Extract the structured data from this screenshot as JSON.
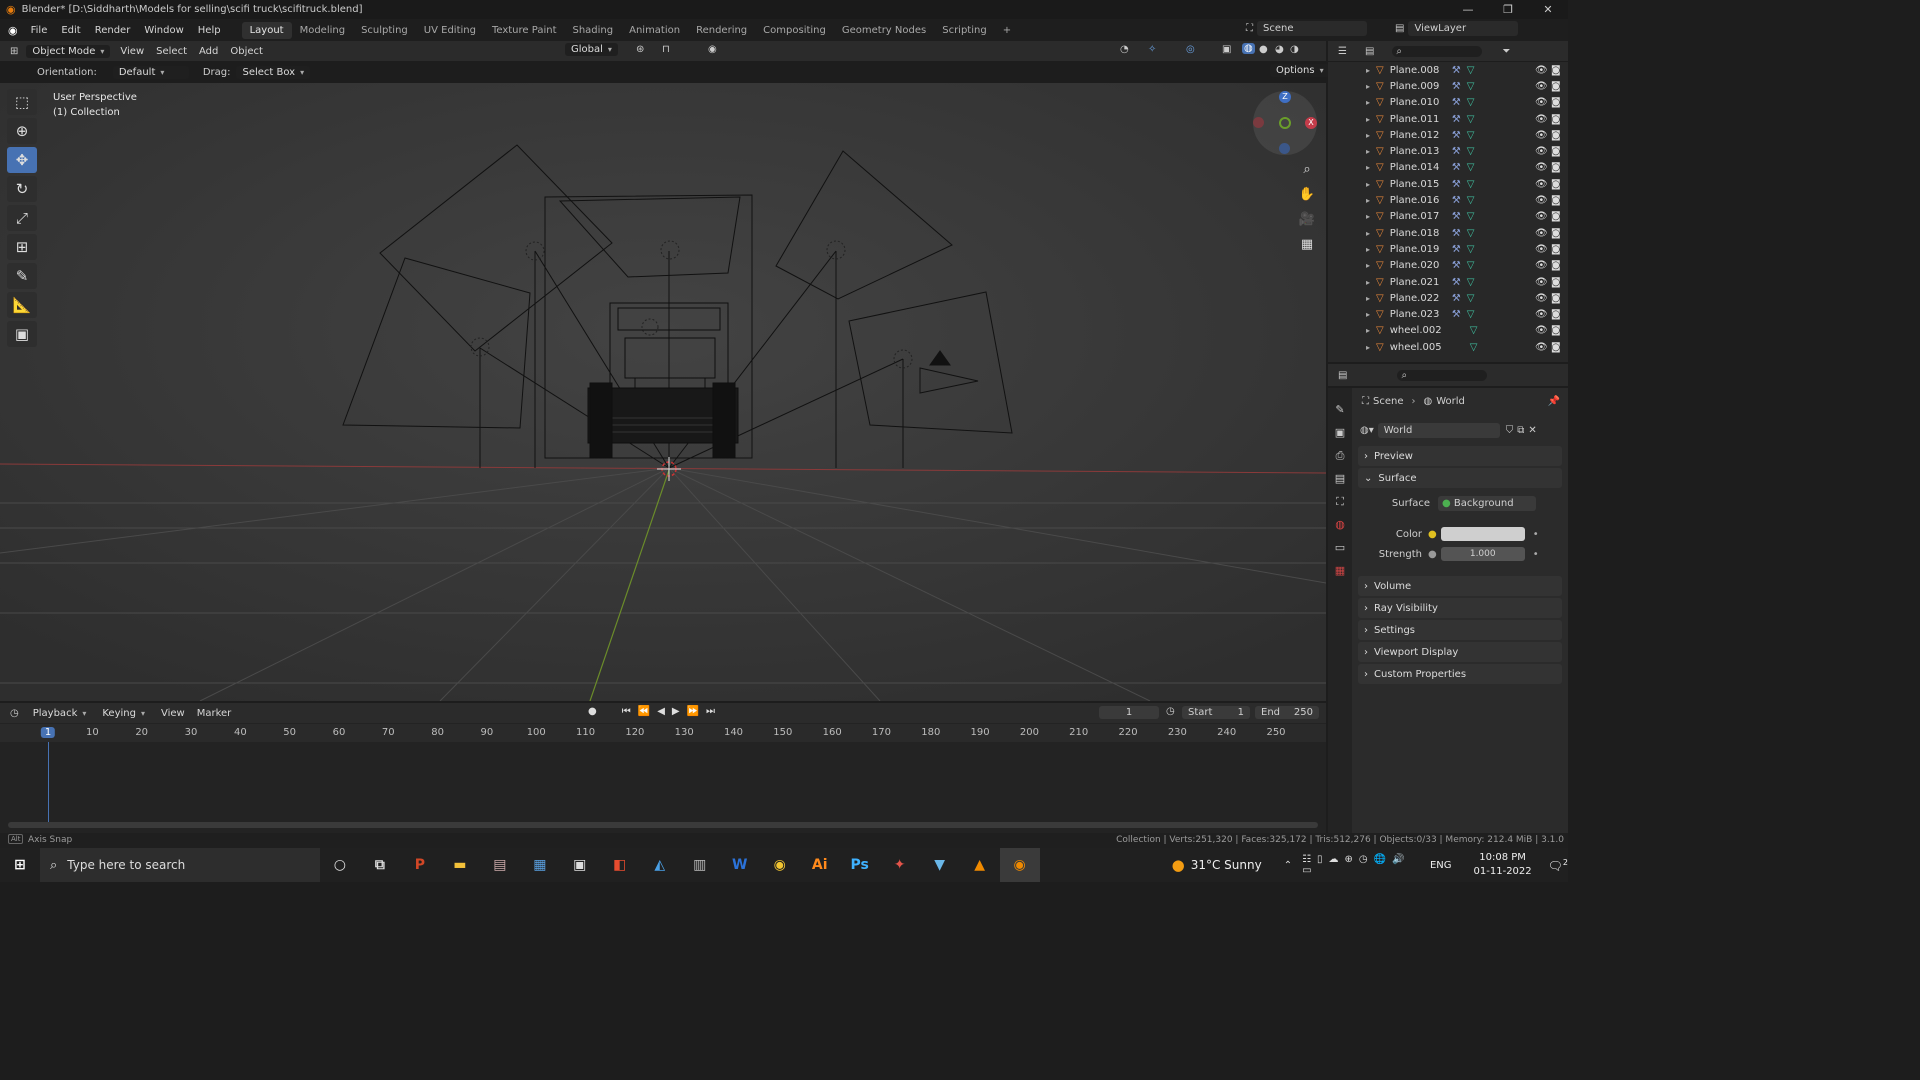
{
  "window": {
    "title": "Blender* [D:\\Siddharth\\Models for selling\\scifi truck\\scifitruck.blend]",
    "min": "—",
    "max": "❐",
    "close": "✕"
  },
  "menu": {
    "items": [
      "File",
      "Edit",
      "Render",
      "Window",
      "Help"
    ],
    "workspaces": [
      "Layout",
      "Modeling",
      "Sculpting",
      "UV Editing",
      "Texture Paint",
      "Shading",
      "Animation",
      "Rendering",
      "Compositing",
      "Geometry Nodes",
      "Scripting",
      "+"
    ],
    "scene": "Scene",
    "viewlayer": "ViewLayer"
  },
  "viewport_header": {
    "mode": "Object Mode",
    "menus": [
      "View",
      "Select",
      "Add",
      "Object"
    ],
    "transform": "Global",
    "options": "Options"
  },
  "tool_options": {
    "orientation_label": "Orientation:",
    "orientation": "Default",
    "drag_label": "Drag:",
    "drag": "Select Box"
  },
  "viewport": {
    "line1": "User Perspective",
    "line2": "(1) Collection",
    "gizmo": {
      "x": "X",
      "y": "Y",
      "z": "Z"
    }
  },
  "outliner": {
    "items": [
      "Plane.008",
      "Plane.009",
      "Plane.010",
      "Plane.011",
      "Plane.012",
      "Plane.013",
      "Plane.014",
      "Plane.015",
      "Plane.016",
      "Plane.017",
      "Plane.018",
      "Plane.019",
      "Plane.020",
      "Plane.021",
      "Plane.022",
      "Plane.023",
      "wheel.002",
      "wheel.005"
    ]
  },
  "properties": {
    "breadcrumb_scene": "Scene",
    "breadcrumb_world": "World",
    "world_name": "World",
    "preview": "Preview",
    "surface": "Surface",
    "surface_label": "Surface",
    "surface_value": "Background",
    "color_label": "Color",
    "strength_label": "Strength",
    "strength_value": "1.000",
    "volume": "Volume",
    "ray_visibility": "Ray Visibility",
    "settings": "Settings",
    "viewport_display": "Viewport Display",
    "custom_properties": "Custom Properties"
  },
  "timeline": {
    "menus": [
      "Playback",
      "Keying",
      "View",
      "Marker"
    ],
    "current_frame": "1",
    "start_label": "Start",
    "start": "1",
    "end_label": "End",
    "end": "250",
    "ticks": [
      "1",
      "10",
      "20",
      "30",
      "40",
      "50",
      "60",
      "70",
      "80",
      "90",
      "100",
      "110",
      "120",
      "130",
      "140",
      "150",
      "160",
      "170",
      "180",
      "190",
      "200",
      "210",
      "220",
      "230",
      "240",
      "250"
    ]
  },
  "status": {
    "left": "Axis Snap",
    "right": "Collection | Verts:251,320 | Faces:325,172 | Tris:512,276 | Objects:0/33 | Memory: 212.4 MiB | 3.1.0"
  },
  "taskbar": {
    "search": "Type here to search",
    "weather": "31°C  Sunny",
    "lang": "ENG",
    "time": "10:08 PM",
    "date": "01-11-2022",
    "notif": "2"
  }
}
